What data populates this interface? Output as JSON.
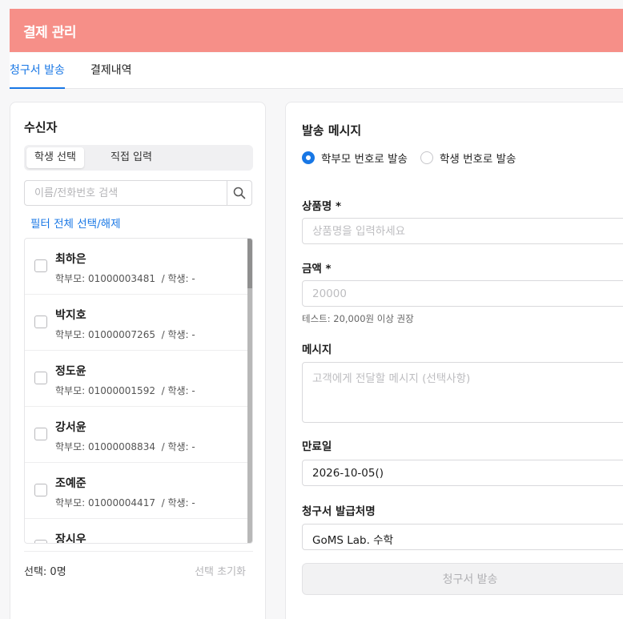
{
  "header": {
    "title": "결제 관리",
    "bg_color": "#f68f88"
  },
  "tabs": [
    {
      "label": "청구서 발송",
      "active": true
    },
    {
      "label": "결제내역",
      "active": false
    }
  ],
  "recipients": {
    "title": "수신자",
    "modes": [
      {
        "label": "학생 선택",
        "active": true
      },
      {
        "label": "직접 입력",
        "active": false
      }
    ],
    "search": {
      "placeholder": "이름/전화번호 검색",
      "value": "",
      "icon": "search-icon"
    },
    "filter_link": "필터 전체 선택/해제",
    "items": [
      {
        "name": "최하은",
        "detail": "학부모: 01000003481  / 학생: -",
        "checked": false
      },
      {
        "name": "박지호",
        "detail": "학부모: 01000007265  / 학생: -",
        "checked": false
      },
      {
        "name": "정도윤",
        "detail": "학부모: 01000001592  / 학생: -",
        "checked": false
      },
      {
        "name": "강서윤",
        "detail": "학부모: 01000008834  / 학생: -",
        "checked": false
      },
      {
        "name": "조예준",
        "detail": "학부모: 01000004417  / 학생: -",
        "checked": false
      },
      {
        "name": "장시우",
        "detail": "",
        "checked": false
      }
    ],
    "selected_count": "선택: 0명",
    "reset_label": "선택 초기화"
  },
  "message": {
    "title": "발송 메시지",
    "radio_options": [
      {
        "label": "학부모 번호로 발송",
        "selected": true
      },
      {
        "label": "학생 번호로 발송",
        "selected": false
      }
    ],
    "product": {
      "label": "상품명 *",
      "placeholder": "상품명을 입력하세요",
      "value": ""
    },
    "amount": {
      "label": "금액 *",
      "placeholder": "20000",
      "value": "",
      "hint": "테스트: 20,000원 이상 권장"
    },
    "memo": {
      "label": "메시지",
      "placeholder": "고객에게 전달할 메시지 (선택사항)",
      "value": ""
    },
    "expiry": {
      "label": "만료일",
      "value": "2026-10-05()"
    },
    "issuer": {
      "label": "청구서 발급처명",
      "value": "GoMS Lab. 수학"
    },
    "submit_label": "청구서 발송",
    "accent_color": "#1877e5"
  }
}
